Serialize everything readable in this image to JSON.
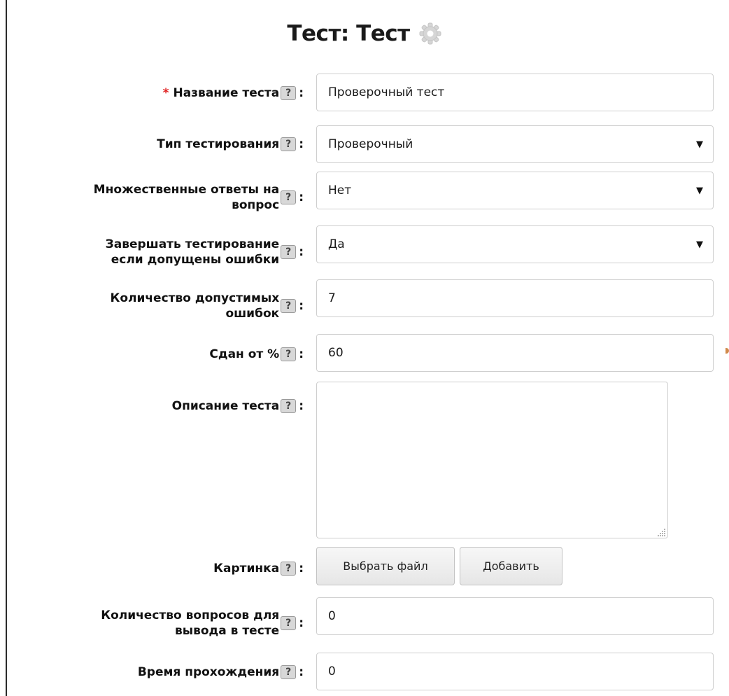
{
  "page": {
    "title": "Тест: Тест",
    "settings_icon": "gear-icon"
  },
  "help_glyph": "?",
  "colon": ":",
  "required_mark": "*",
  "fields": {
    "test_name": {
      "label": "Название теста",
      "value": "Проверочный тест",
      "required": true
    },
    "test_type": {
      "label": "Тип тестирования",
      "value": "Проверочный"
    },
    "multi_answers": {
      "label_line1": "Множественные ответы на",
      "label_line2": "вопрос",
      "value": "Нет"
    },
    "stop_on_errors": {
      "label_line1": "Завершать тестирование",
      "label_line2": "если допущены ошибки",
      "value": "Да"
    },
    "allowed_errors": {
      "label_line1": "Количество допустимых",
      "label_line2": "ошибок",
      "value": "7"
    },
    "pass_percent": {
      "label": "Сдан от %",
      "value": "60"
    },
    "description": {
      "label": "Описание теста",
      "value": ""
    },
    "image": {
      "label": "Картинка",
      "choose_file": "Выбрать файл",
      "add": "Добавить"
    },
    "question_count": {
      "label_line1": "Количество вопросов для",
      "label_line2": "вывода в тесте",
      "value": "0"
    },
    "time_limit": {
      "label": "Время прохождения",
      "value": "0"
    }
  },
  "colors": {
    "required": "#e02020",
    "border": "#cfcfcf",
    "help_bg": "#d8d8d8"
  }
}
